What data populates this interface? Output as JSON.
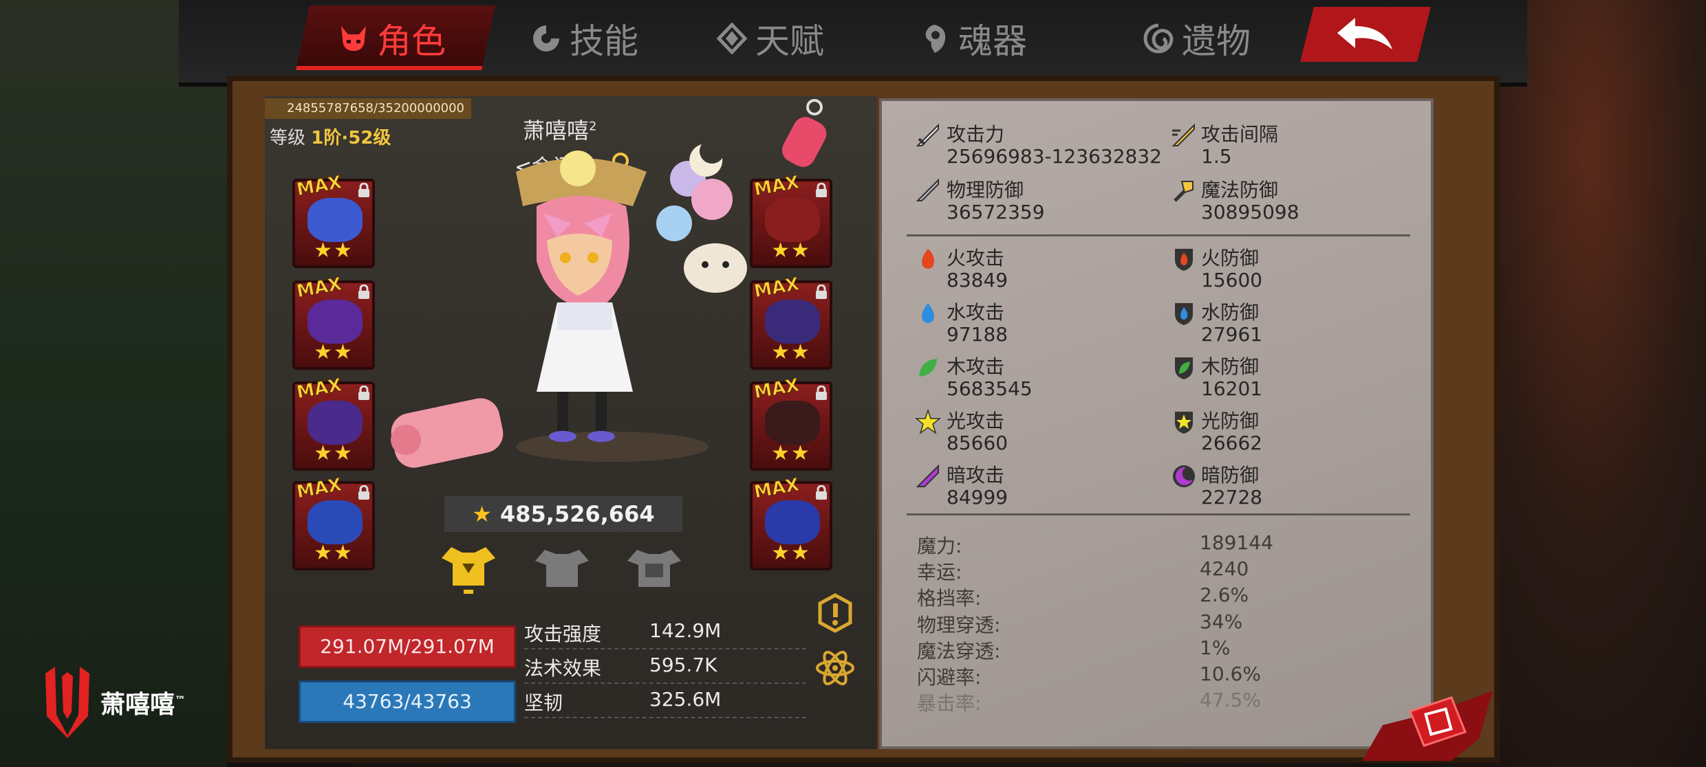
{
  "nav": {
    "tabs": [
      {
        "label": "角色",
        "icon": "devil-face-icon",
        "active": true
      },
      {
        "label": "技能",
        "icon": "skill-swirl-icon",
        "active": false
      },
      {
        "label": "天赋",
        "icon": "talent-diamond-icon",
        "active": false
      },
      {
        "label": "魂器",
        "icon": "soul-vessel-icon",
        "active": false
      },
      {
        "label": "遗物",
        "icon": "relic-spiral-icon",
        "active": false
      }
    ],
    "back_icon": "back-arrow-icon"
  },
  "character": {
    "exp_text": "24855787658/35200000000",
    "level_prefix": "等级",
    "level_value": "1阶·52级",
    "name": "萧嘻嘻",
    "name_sup": "2",
    "title": "<金闪闪>",
    "power": "485,526,664",
    "hp": "291.07M/291.07M",
    "mp": "43763/43763",
    "main_stats": [
      {
        "label": "攻击强度",
        "value": "142.9M"
      },
      {
        "label": "法术效果",
        "value": "595.7K"
      },
      {
        "label": "坚韧",
        "value": "325.6M"
      }
    ],
    "equipment_left": [
      {
        "badge": "MAX",
        "stars": "★★",
        "color": "#3d5ad1"
      },
      {
        "badge": "MAX",
        "stars": "★★",
        "color": "#5a2a9a"
      },
      {
        "badge": "MAX",
        "stars": "★★",
        "color": "#4a2a8a"
      },
      {
        "badge": "MAX",
        "stars": "★★",
        "color": "#2a4ab8"
      }
    ],
    "equipment_right": [
      {
        "badge": "MAX",
        "stars": "★★",
        "color": "#8a1e1e"
      },
      {
        "badge": "MAX",
        "stars": "★★",
        "color": "#3a2a7a"
      },
      {
        "badge": "MAX",
        "stars": "★★",
        "color": "#3a1a1a"
      },
      {
        "badge": "MAX",
        "stars": "★★",
        "color": "#2a3aa8"
      }
    ]
  },
  "stats": {
    "attack_label": "攻击力",
    "attack_value": "25696983-123632832",
    "interval_label": "攻击间隔",
    "interval_value": "1.5",
    "pdef_label": "物理防御",
    "pdef_value": "36572359",
    "mdef_label": "魔法防御",
    "mdef_value": "30895098",
    "elements": [
      {
        "atk_label": "火攻击",
        "atk_value": "83849",
        "def_label": "火防御",
        "def_value": "15600",
        "color": "#e5461e"
      },
      {
        "atk_label": "水攻击",
        "atk_value": "97188",
        "def_label": "水防御",
        "def_value": "27961",
        "color": "#2d8ee0"
      },
      {
        "atk_label": "木攻击",
        "atk_value": "5683545",
        "def_label": "木防御",
        "def_value": "16201",
        "color": "#3fb043"
      },
      {
        "atk_label": "光攻击",
        "atk_value": "85660",
        "def_label": "光防御",
        "def_value": "26662",
        "color": "#f4e22a"
      },
      {
        "atk_label": "暗攻击",
        "atk_value": "84999",
        "def_label": "暗防御",
        "def_value": "22728",
        "color": "#b03ad0"
      }
    ],
    "extra": [
      {
        "label": "魔力:",
        "value": "189144"
      },
      {
        "label": "幸运:",
        "value": "4240"
      },
      {
        "label": "格挡率:",
        "value": "2.6%"
      },
      {
        "label": "物理穿透:",
        "value": "34%"
      },
      {
        "label": "魔法穿透:",
        "value": "1%"
      },
      {
        "label": "闪避率:",
        "value": "10.6%"
      },
      {
        "label": "暴击率:",
        "value": "47.5%"
      }
    ]
  },
  "brand": {
    "name": "萧嘻嘻",
    "tm": "™",
    "logo_icon": "red-magic-logo-icon"
  },
  "colors": {
    "accent": "#e32222",
    "hp": "#c0262a",
    "mp": "#2b78b8",
    "gold": "#f3c640"
  }
}
